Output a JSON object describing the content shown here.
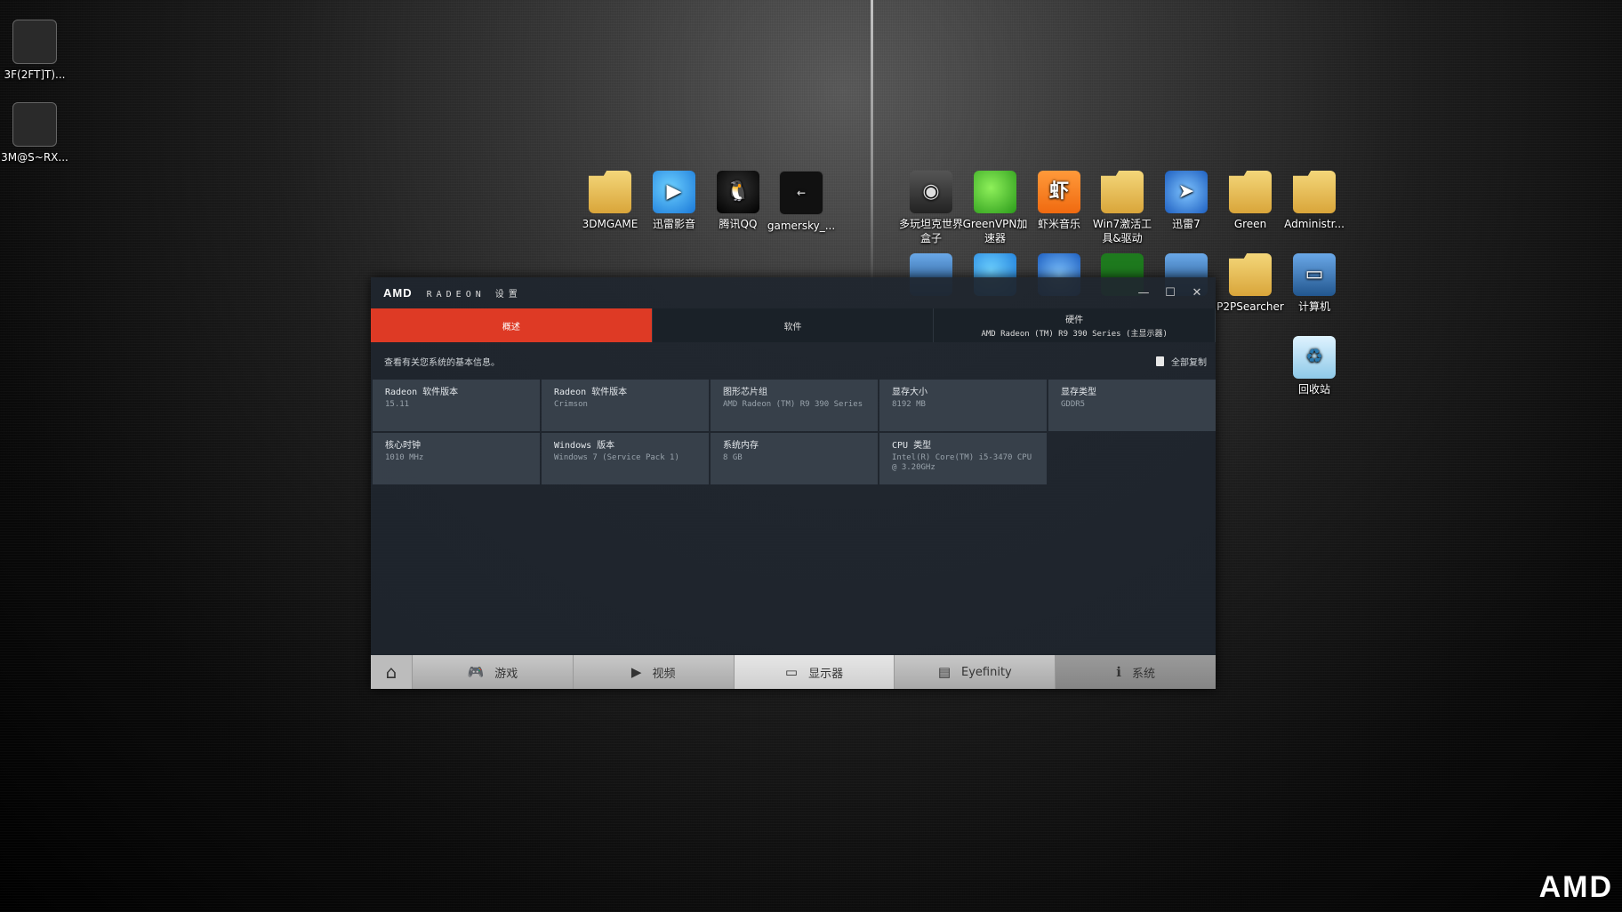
{
  "desktop": {
    "icons": [
      {
        "label": "3F(2FT]T)...",
        "glyph": "■"
      },
      {
        "label": "3M@S~RX...",
        "glyph": "■"
      },
      {
        "label": "3DMGAME",
        "glyph": ""
      },
      {
        "label": "迅雷影音",
        "glyph": "▶"
      },
      {
        "label": "腾讯QQ",
        "glyph": "🐧"
      },
      {
        "label": "gamersky_...",
        "glyph": "←"
      },
      {
        "label": "多玩坦克世界盒子",
        "glyph": "◉"
      },
      {
        "label": "GreenVPN加速器",
        "glyph": ""
      },
      {
        "label": "虾米音乐",
        "glyph": "虾"
      },
      {
        "label": "Win7激活工具&驱动",
        "glyph": ""
      },
      {
        "label": "迅雷7",
        "glyph": "➤"
      },
      {
        "label": "Green",
        "glyph": ""
      },
      {
        "label": "Administr...",
        "glyph": ""
      },
      {
        "label": "P2PSearcher",
        "glyph": ""
      },
      {
        "label": "计算机",
        "glyph": "▭"
      },
      {
        "label": "回收站",
        "glyph": "♻"
      }
    ],
    "corner_logo": "AMD"
  },
  "window": {
    "logo": "AMD",
    "brand": "RADEON 设置",
    "controls": {
      "minimize": "—",
      "maximize": "☐",
      "close": "✕"
    },
    "tabs": [
      {
        "label": "概述",
        "sub": ""
      },
      {
        "label": "软件",
        "sub": ""
      },
      {
        "label": "硬件",
        "sub": "AMD Radeon (TM) R9 390 Series (主显示器)"
      }
    ],
    "info_text": "查看有关您系统的基本信息。",
    "copy_all": "全部复制",
    "cells": [
      {
        "label": "Radeon 软件版本",
        "value": "15.11"
      },
      {
        "label": "Radeon 软件版本",
        "value": "Crimson"
      },
      {
        "label": "图形芯片组",
        "value": "AMD Radeon (TM) R9 390 Series"
      },
      {
        "label": "显存大小",
        "value": "8192 MB"
      },
      {
        "label": "显存类型",
        "value": "GDDR5"
      },
      {
        "label": "核心时钟",
        "value": "1010 MHz"
      },
      {
        "label": "Windows 版本",
        "value": "Windows 7 (Service Pack 1)"
      },
      {
        "label": "系统内存",
        "value": "8 GB"
      },
      {
        "label": "CPU 类型",
        "value": "Intel(R) Core(TM) i5-3470 CPU @ 3.20GHz"
      }
    ],
    "nav": {
      "home_icon": "⌂",
      "items": [
        {
          "label": "游戏",
          "icon": "🎮"
        },
        {
          "label": "视频",
          "icon": "▶"
        },
        {
          "label": "显示器",
          "icon": "▭"
        },
        {
          "label": "Eyefinity",
          "icon": "▤"
        },
        {
          "label": "系统",
          "icon": "ℹ"
        }
      ]
    }
  }
}
